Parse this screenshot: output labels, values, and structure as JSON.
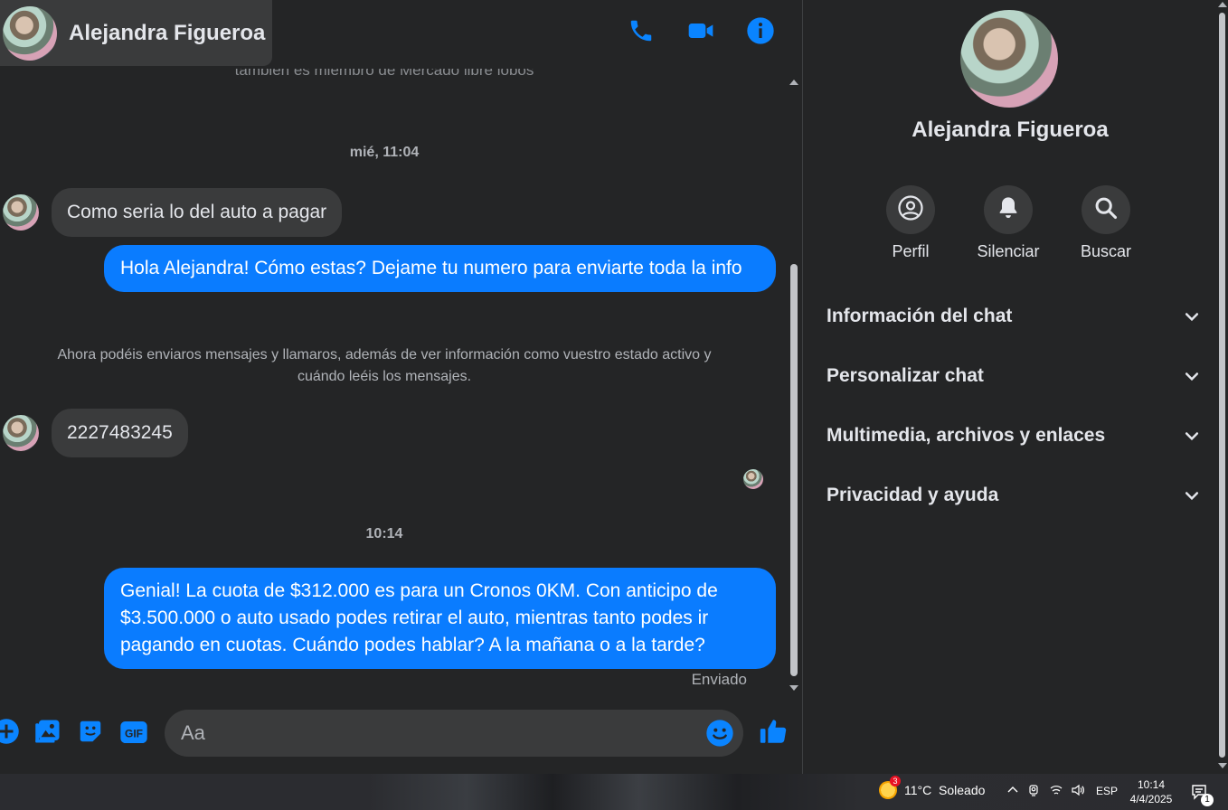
{
  "header": {
    "contact_name": "Alejandra Figueroa",
    "icons": [
      "phone-icon",
      "video-icon",
      "info-icon"
    ]
  },
  "messages": {
    "cutoff_text": "también es miembro de Mercado libre lobos",
    "timestamp_1": "mié, 11:04",
    "incoming_1": "Como seria lo del auto a pagar",
    "outgoing_1": "Hola Alejandra! Cómo estas? Dejame tu numero para enviarte toda la info",
    "system_notice": "Ahora podéis enviaros mensajes y llamaros, además de ver información como vuestro estado activo y cuándo leéis los mensajes.",
    "incoming_2": "2227483245",
    "timestamp_2": "10:14",
    "outgoing_2": "Genial! La cuota de $312.000 es para un Cronos 0KM. Con anticipo de $3.500.000 o auto usado podes retirar el auto, mientras tanto podes ir pagando en cuotas. Cuándo podes hablar? A la mañana o a la tarde?",
    "status": "Enviado"
  },
  "composer": {
    "placeholder": "Aa",
    "icons": [
      "plus-icon",
      "image-icon",
      "sticker-icon",
      "gif-icon",
      "emoji-icon",
      "like-icon"
    ],
    "gif_label": "GIF"
  },
  "details": {
    "name": "Alejandra Figueroa",
    "actions": [
      {
        "label": "Perfil",
        "icon": "profile-icon"
      },
      {
        "label": "Silenciar",
        "icon": "bell-icon"
      },
      {
        "label": "Buscar",
        "icon": "search-icon"
      }
    ],
    "sections": [
      {
        "label": "Información del chat"
      },
      {
        "label": "Personalizar chat"
      },
      {
        "label": "Multimedia, archivos y enlaces"
      },
      {
        "label": "Privacidad y ayuda"
      }
    ]
  },
  "taskbar": {
    "weather_badge": "3",
    "weather": "11°C  Soleado",
    "language": "ESP",
    "time": "10:14",
    "date": "4/4/2025",
    "notification_count": "1"
  },
  "colors": {
    "background": "#242526",
    "bubble_in": "#3a3b3c",
    "bubble_out": "#0a7cff",
    "accent": "#0a84ff",
    "text": "#e4e6eb",
    "muted": "#b0b3b8"
  }
}
